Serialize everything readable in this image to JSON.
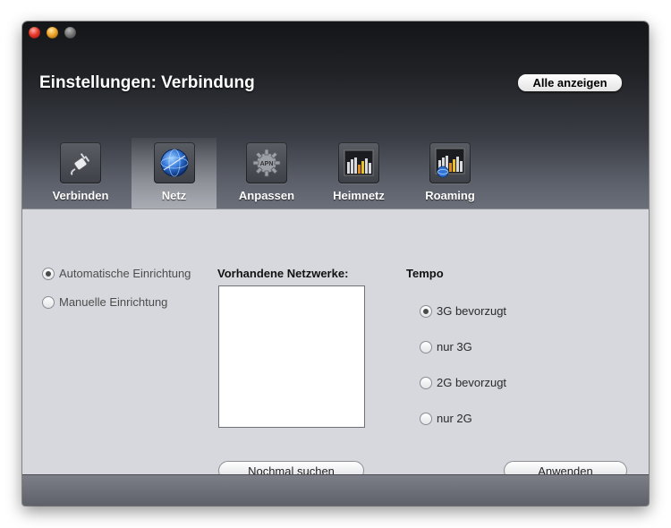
{
  "window": {
    "title": "Einstellungen: Verbindung",
    "show_all_label": "Alle anzeigen"
  },
  "tabs": [
    {
      "label": "Verbinden",
      "icon": "plug-icon",
      "active": false
    },
    {
      "label": "Netz",
      "icon": "globe-icon",
      "active": true
    },
    {
      "label": "Anpassen",
      "icon": "apn-gear-icon",
      "active": false
    },
    {
      "label": "Heimnetz",
      "icon": "signal-bars-icon",
      "active": false
    },
    {
      "label": "Roaming",
      "icon": "signal-bars-globe-icon",
      "active": false
    }
  ],
  "apn_icon_text": "APN",
  "setup": {
    "automatic_label": "Automatische Einrichtung",
    "manual_label": "Manuelle Einrichtung",
    "selected": "automatic"
  },
  "networks": {
    "label": "Vorhandene Netzwerke:",
    "items": [],
    "rescan_label": "Nochmal suchen"
  },
  "speed": {
    "label": "Tempo",
    "options": [
      "3G bevorzugt",
      "nur 3G",
      "2G bevorzugt",
      "nur 2G"
    ],
    "selected": "3G bevorzugt"
  },
  "apply_label": "Anwenden",
  "colors": {
    "header_dark": "#141518",
    "content_bg": "#d6d8dd",
    "footer": "#6b6e76"
  }
}
